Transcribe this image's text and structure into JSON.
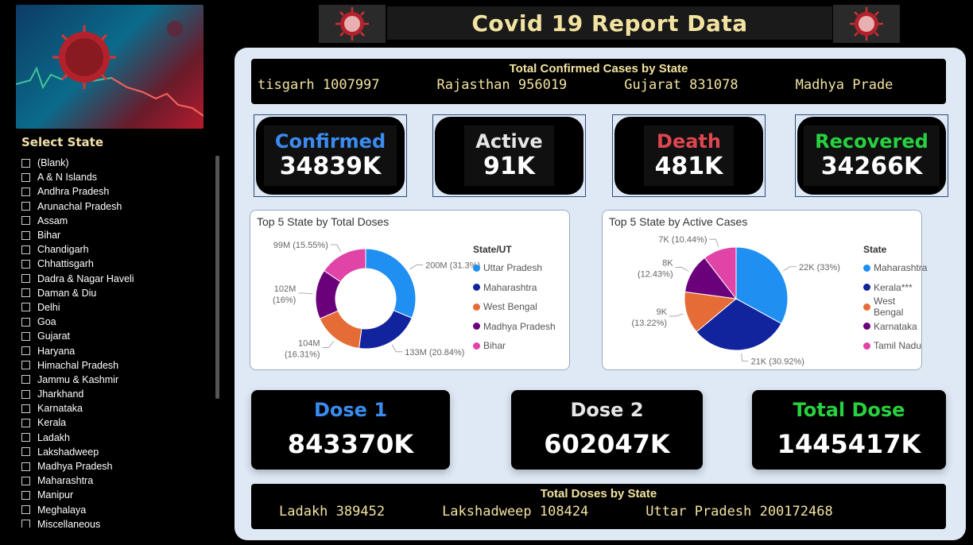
{
  "header": {
    "title": "Covid 19 Report Data"
  },
  "slicer": {
    "title": "Select State",
    "items": [
      "(Blank)",
      "A & N Islands",
      "Andhra Pradesh",
      "Arunachal Pradesh",
      "Assam",
      "Bihar",
      "Chandigarh",
      "Chhattisgarh",
      "Dadra & Nagar Haveli",
      "Daman & Diu",
      "Delhi",
      "Goa",
      "Gujarat",
      "Haryana",
      "Himachal Pradesh",
      "Jammu & Kashmir",
      "Jharkhand",
      "Karnataka",
      "Kerala",
      "Ladakh",
      "Lakshadweep",
      "Madhya Pradesh",
      "Maharashtra",
      "Manipur",
      "Meghalaya",
      "Miscellaneous"
    ]
  },
  "ticker_top": {
    "title": "Total Confirmed Cases by State",
    "items": [
      "tisgarh 1007997",
      "Rajasthan 956019",
      "Gujarat 831078",
      "Madhya Prade"
    ]
  },
  "kpis": {
    "confirmed": {
      "label": "Confirmed",
      "value": "34839K",
      "color": "#3a8cf0"
    },
    "active": {
      "label": "Active",
      "value": "91K",
      "color": "#e6e6e6"
    },
    "death": {
      "label": "Death",
      "value": "481K",
      "color": "#e0464f"
    },
    "recovered": {
      "label": "Recovered",
      "value": "34266K",
      "color": "#27d13f"
    }
  },
  "chart_data": [
    {
      "type": "pie",
      "variant": "donut",
      "title": "Top 5 State by Total Doses",
      "legend_title": "State/UT",
      "legend_position": "right",
      "categories": [
        "Uttar Pradesh",
        "Maharashtra",
        "West Bengal",
        "Madhya Pradesh",
        "Bihar"
      ],
      "values": [
        31.3,
        20.84,
        16.31,
        16,
        15.55
      ],
      "labels": [
        "200M (31.3%)",
        "133M (20.84%)",
        "104M",
        "102M",
        "99M (15.55%)"
      ],
      "labels_pct": [
        "",
        "",
        "(16.31%)",
        "(16%)",
        ""
      ],
      "colors": [
        "#1f8ff2",
        "#12239e",
        "#e66c37",
        "#6b007b",
        "#e044a7"
      ]
    },
    {
      "type": "pie",
      "title": "Top 5 State by Active Cases",
      "legend_title": "State",
      "legend_position": "right",
      "categories": [
        "Maharashtra",
        "Kerala***",
        "West Bengal",
        "Karnataka",
        "Tamil Nadu"
      ],
      "values": [
        33,
        30.92,
        13.22,
        12.43,
        10.44
      ],
      "labels": [
        "22K (33%)",
        "21K (30.92%)",
        "9K",
        "8K",
        "7K (10.44%)"
      ],
      "labels_pct": [
        "",
        "",
        "(13.22%)",
        "(12.43%)",
        ""
      ],
      "colors": [
        "#1f8ff2",
        "#12239e",
        "#e66c37",
        "#6b007b",
        "#e044a7"
      ]
    }
  ],
  "doses": {
    "dose1": {
      "label": "Dose 1",
      "value": "843370K",
      "color": "#3a8cf0"
    },
    "dose2": {
      "label": "Dose 2",
      "value": "602047K",
      "color": "#e6e6e6"
    },
    "total": {
      "label": "Total Dose",
      "value": "1445417K",
      "color": "#27d13f"
    }
  },
  "ticker_bottom": {
    "title": "Total Doses by State",
    "items": [
      "Ladakh 389452",
      "Lakshadweep 108424",
      "Uttar Pradesh 200172468"
    ]
  }
}
